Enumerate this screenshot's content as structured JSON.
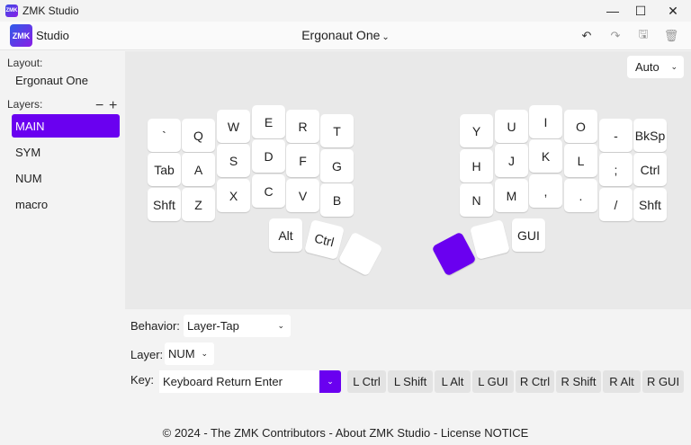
{
  "window": {
    "title": "ZMK Studio",
    "icon_text": "ZMK",
    "controls": [
      "minimize-icon",
      "maximize-icon",
      "close-icon"
    ]
  },
  "header": {
    "logo_text": "ZMK",
    "studio_label": "Studio",
    "keyboard_name": "Ergonaut One",
    "icons": [
      "undo-icon",
      "redo-icon",
      "save-icon",
      "trash-icon"
    ]
  },
  "sidebar": {
    "layout_label": "Layout:",
    "layout_value": "Ergonaut One",
    "layers_label": "Layers:",
    "remove_layer": "−",
    "add_layer": "+",
    "layers": [
      "MAIN",
      "SYM",
      "NUM",
      "macro"
    ],
    "selected_layer": "MAIN"
  },
  "canvas": {
    "zoom_value": "Auto",
    "keys": [
      "`",
      "Q",
      "W",
      "E",
      "R",
      "T",
      "Tab",
      "A",
      "S",
      "D",
      "F",
      "G",
      "Shft",
      "Z",
      "X",
      "C",
      "V",
      "B",
      "Alt",
      "Ctrl",
      "",
      "Y",
      "U",
      "I",
      "O",
      "-",
      "BkSp",
      "H",
      "J",
      "K",
      "L",
      ";",
      "Ctrl",
      "N",
      "M",
      ",",
      ".",
      "/",
      "Shft",
      "GUI",
      "",
      ""
    ]
  },
  "editor": {
    "behavior_label": "Behavior:",
    "behavior_value": "Layer-Tap",
    "layer_label": "Layer:",
    "layer_value": "NUM",
    "key_label": "Key:",
    "key_value": "Keyboard Return Enter",
    "modifiers": [
      "L Ctrl",
      "L Shift",
      "L Alt",
      "L GUI",
      "R Ctrl",
      "R Shift",
      "R Alt",
      "R GUI"
    ]
  },
  "footer": {
    "text": "© 2024 - The ZMK Contributors - About ZMK Studio - License NOTICE"
  },
  "colors": {
    "accent": "#6a00f0",
    "canvas_bg": "#e9e9e9",
    "key_bg": "#ffffff"
  }
}
